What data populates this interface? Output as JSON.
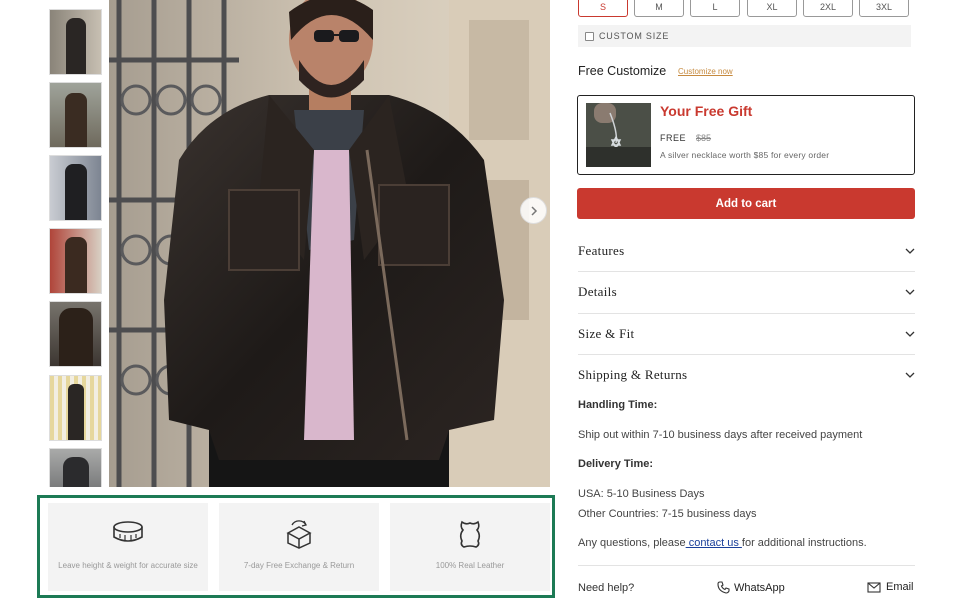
{
  "gallery": {
    "thumbnail_count": 7,
    "next_arrow_icon": "chevron-right-icon"
  },
  "sizes": {
    "options": [
      "S",
      "M",
      "L",
      "XL",
      "2XL",
      "3XL"
    ],
    "selected": "S"
  },
  "custom_size": {
    "label": "CUSTOM SIZE",
    "checked": false
  },
  "customize": {
    "label": "Free Customize",
    "link": "Customize now"
  },
  "gift": {
    "title": "Your Free Gift",
    "price_label": "FREE",
    "old_price": "$85",
    "description": "A silver necklace worth $85 for every order"
  },
  "add_to_cart": "Add to cart",
  "accordion": [
    {
      "label": "Features"
    },
    {
      "label": "Details"
    },
    {
      "label": "Size & Fit"
    },
    {
      "label": "Shipping & Returns"
    }
  ],
  "shipping": {
    "handling_title": "Handling Time:",
    "handling_text": "Ship out within 7-10 business days after received payment",
    "delivery_title": "Delivery Time:",
    "usa": "USA: 5-10 Business Days",
    "other": "Other Countries: 7-15 business days",
    "questions_prefix": "Any questions, please",
    "contact_link": " contact us ",
    "questions_suffix": "for additional instructions."
  },
  "help": {
    "label": "Need help?",
    "whatsapp": "WhatsApp",
    "email": "Email"
  },
  "features": [
    {
      "icon": "measuring-tape-icon",
      "text": "Leave height & weight for accurate size"
    },
    {
      "icon": "exchange-box-icon",
      "text": "7-day Free Exchange & Return"
    },
    {
      "icon": "leather-hide-icon",
      "text": "100% Real Leather"
    }
  ],
  "colors": {
    "accent": "#c9392f",
    "feature_border": "#1c7a55",
    "link": "#1a3f9a",
    "customize_link": "#c68a3f"
  }
}
